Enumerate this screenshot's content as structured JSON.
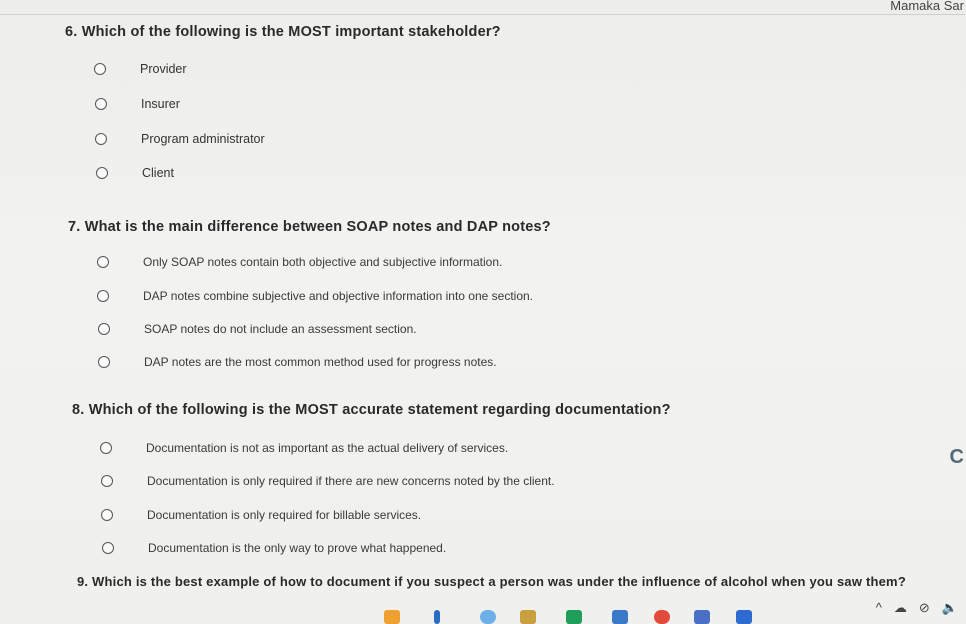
{
  "header": {
    "user_name": "Mamaka Sar"
  },
  "questions": [
    {
      "text": "6. Which of the following is the MOST important stakeholder?",
      "options": [
        "Provider",
        "Insurer",
        "Program administrator",
        "Client"
      ]
    },
    {
      "text": "7. What is the main difference between SOAP notes and DAP notes?",
      "options": [
        "Only SOAP notes contain both objective and subjective information.",
        "DAP notes combine subjective and objective information into one section.",
        "SOAP notes do not include an assessment section.",
        "DAP notes are the most common method used for progress notes."
      ]
    },
    {
      "text": "8. Which of the following is the MOST accurate statement regarding documentation?",
      "options": [
        "Documentation is not as important as the actual delivery of services.",
        "Documentation is only required if there are new concerns noted by the client.",
        "Documentation is only required for billable services.",
        "Documentation is the only way to prove what happened."
      ]
    },
    {
      "text": "9. Which is the best example of how to document if you suspect a person was under the influence of alcohol when you saw them?",
      "options": []
    }
  ],
  "icons": {
    "edge": "edge-icon",
    "tray": [
      "chevron-up-icon",
      "onedrive-icon",
      "network-icon",
      "volume-icon"
    ]
  },
  "colors": {
    "taskbar_icons": [
      "#f0a030",
      "#2b6cc4",
      "#6db0e8",
      "#1f9e5a",
      "#c8a040",
      "#3a78c8",
      "#e24a3b",
      "#4a6fc4",
      "#2d6bd0"
    ]
  }
}
